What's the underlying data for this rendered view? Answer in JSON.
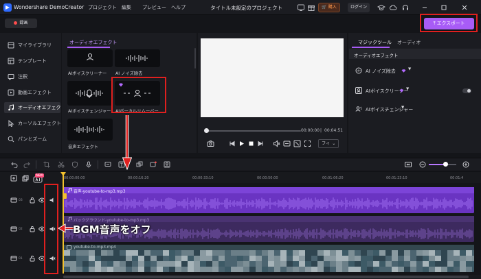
{
  "app": {
    "name": "Wondershare DemoCreator",
    "menus": [
      "プロジェクト",
      "編集",
      "プレビュー",
      "ヘルプ"
    ],
    "project_title": "タイトル未設定のプロジェクト",
    "buy_label": "購入",
    "login_label": "ログイン"
  },
  "toolbar": {
    "record_label": "録画",
    "export_label": "エクスポート"
  },
  "sidebar": {
    "items": [
      {
        "label": "マイライブラリ",
        "icon": "library-icon"
      },
      {
        "label": "テンプレート",
        "icon": "template-icon"
      },
      {
        "label": "注釈",
        "icon": "annotation-icon"
      },
      {
        "label": "動画エフェクト",
        "icon": "video-effect-icon"
      },
      {
        "label": "オーディオエフェクト",
        "icon": "audio-effect-icon",
        "active": true
      },
      {
        "label": "カーソルエフェクト",
        "icon": "cursor-icon"
      },
      {
        "label": "パンとズーム",
        "icon": "pan-zoom-icon"
      }
    ]
  },
  "browser": {
    "tab": "オーディオエフェクト",
    "cards": [
      {
        "label": "AIボイスクリーナー"
      },
      {
        "label": "AI ノイズ除去"
      },
      {
        "label": "AIボイスチェンジャー"
      },
      {
        "label": "AIボーカルリムーバー"
      },
      {
        "label": "音声エフェクト"
      }
    ]
  },
  "preview": {
    "current_time": "00:00:00",
    "separator": "|",
    "total_time": "00:04:51",
    "fit_label": "フィ"
  },
  "right_panel": {
    "tabs": [
      "マジックツール",
      "オーディオ"
    ],
    "section": "オーディオエフェクト",
    "items": [
      {
        "label": "AI ノイズ除去"
      },
      {
        "label": "AIボイスクリーナー"
      },
      {
        "label": "AIボイスチェンジャー"
      }
    ]
  },
  "timeline": {
    "new_badge": "NEW",
    "ruler_ticks": [
      "00:00:00:00",
      "00:00:16:20",
      "00:00:33:10",
      "00:00:50:00",
      "00:01:06:20",
      "00:01:23:10",
      "00:01:4"
    ],
    "tracks": [
      {
        "number": "03",
        "clip": "音声-youtube-to-mp3.mp3"
      },
      {
        "number": "02",
        "clip": "バックグラウンド-youtube-to-mp3.mp3"
      },
      {
        "number": "01",
        "clip": "youtube-to-mp3.mp4"
      }
    ],
    "zoom_level": 0.6
  },
  "annotation": {
    "text": "BGM音声をオフ"
  },
  "colors": {
    "accent": "#a85cf6",
    "highlight": "#e0201f",
    "playhead": "#f2c12e"
  }
}
